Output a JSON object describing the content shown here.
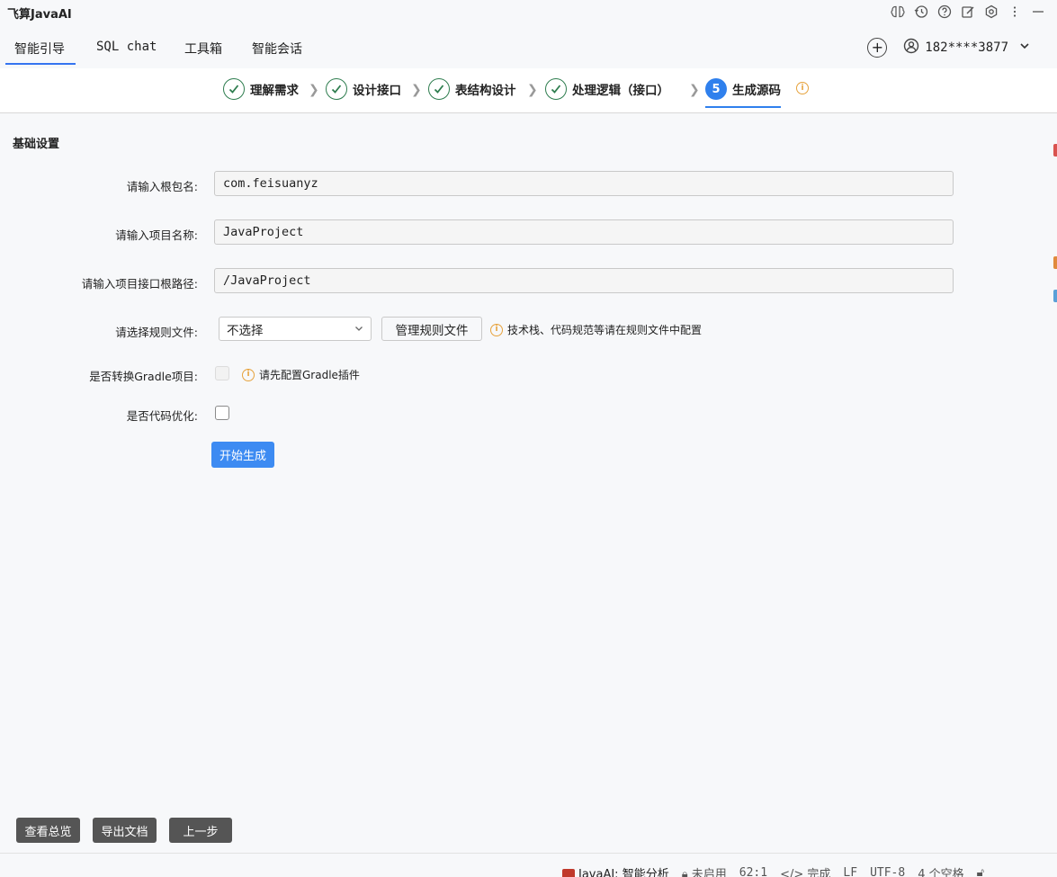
{
  "app": {
    "title": "飞算JavaAI"
  },
  "title_icons": [
    "brain-icon",
    "history-icon",
    "help-icon",
    "edit-icon",
    "settings-icon",
    "more-icon",
    "minimize-icon"
  ],
  "tabs": [
    {
      "label": "智能引导",
      "active": true
    },
    {
      "label": "SQL chat",
      "active": false
    },
    {
      "label": "工具箱",
      "active": false
    },
    {
      "label": "智能会话",
      "active": false
    }
  ],
  "user": {
    "phone": "182****3877"
  },
  "steps": [
    {
      "label": "理解需求",
      "status": "done"
    },
    {
      "label": "设计接口",
      "status": "done"
    },
    {
      "label": "表结构设计",
      "status": "done"
    },
    {
      "label": "处理逻辑（接口）",
      "status": "done"
    },
    {
      "label": "生成源码",
      "number": "5",
      "status": "active"
    }
  ],
  "form": {
    "section_title": "基础设置",
    "package_label": "请输入根包名:",
    "package_value": "com.feisuanyz",
    "project_label": "请输入项目名称:",
    "project_value": "JavaProject",
    "path_label": "请输入项目接口根路径:",
    "path_value": "/JavaProject",
    "rule_label": "请选择规则文件:",
    "rule_selected": "不选择",
    "manage_rules_button": "管理规则文件",
    "rule_hint": "技术栈、代码规范等请在规则文件中配置",
    "gradle_label": "是否转换Gradle项目:",
    "gradle_hint": "请先配置Gradle插件",
    "gradle_checked": false,
    "optimize_label": "是否代码优化:",
    "optimize_checked": false,
    "start_button": "开始生成"
  },
  "bottom_buttons": {
    "overview": "查看总览",
    "export": "导出文档",
    "previous": "上一步"
  },
  "status_bar": {
    "plugin": "JavaAI: 智能分析",
    "lock": "未启用",
    "position": "62:1",
    "status": "完成",
    "line_ending": "LF",
    "encoding": "UTF-8",
    "indent": "4 个空格"
  },
  "colors": {
    "accent": "#3d8bf2",
    "check_green": "#2e7d4f",
    "info_orange": "#e6a23c",
    "dark_button": "#555555"
  }
}
